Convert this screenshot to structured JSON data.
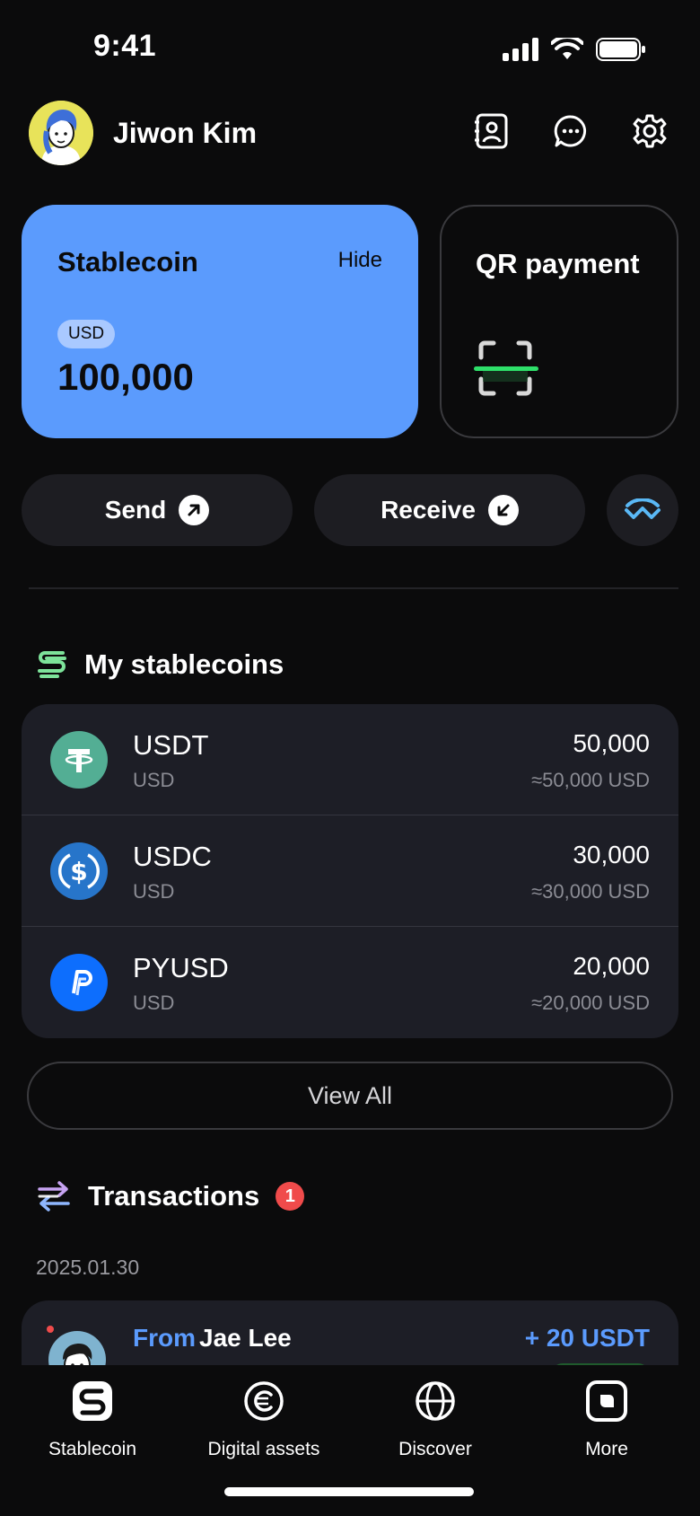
{
  "status_bar": {
    "time": "9:41"
  },
  "header": {
    "user_name": "Jiwon Kim"
  },
  "stablecoin_card": {
    "title": "Stablecoin",
    "hide_label": "Hide",
    "currency": "USD",
    "amount": "100,000"
  },
  "qr_card": {
    "title": "QR payment"
  },
  "actions": {
    "send_label": "Send",
    "receive_label": "Receive"
  },
  "my_stablecoins": {
    "title": "My stablecoins",
    "coins": [
      {
        "name": "USDT",
        "currency": "USD",
        "amount": "50,000",
        "approx": "≈50,000 USD",
        "icon": "tether-icon",
        "color": "#53ae94"
      },
      {
        "name": "USDC",
        "currency": "USD",
        "amount": "30,000",
        "approx": "≈30,000 USD",
        "icon": "usdc-icon",
        "color": "#2775ca"
      },
      {
        "name": "PYUSD",
        "currency": "USD",
        "amount": "20,000",
        "approx": "≈20,000 USD",
        "icon": "paypal-icon",
        "color": "#0d6efd"
      }
    ],
    "view_all_label": "View All"
  },
  "transactions": {
    "title": "Transactions",
    "badge_count": "1",
    "date": "2025.01.30",
    "items": [
      {
        "direction": "From",
        "name": "Jae Lee",
        "amount": "+ 20 USDT"
      }
    ]
  },
  "tab_bar": {
    "tabs": [
      {
        "label": "Stablecoin",
        "icon": "stablecoin-icon"
      },
      {
        "label": "Digital assets",
        "icon": "digital-assets-icon"
      },
      {
        "label": "Discover",
        "icon": "globe-icon"
      },
      {
        "label": "More",
        "icon": "more-icon"
      }
    ]
  },
  "colors": {
    "accent": "#5b9bfd",
    "background": "#0b0b0c",
    "card": "#1d1e26",
    "badge": "#f04b4b",
    "scan_line": "#2ee06a"
  }
}
